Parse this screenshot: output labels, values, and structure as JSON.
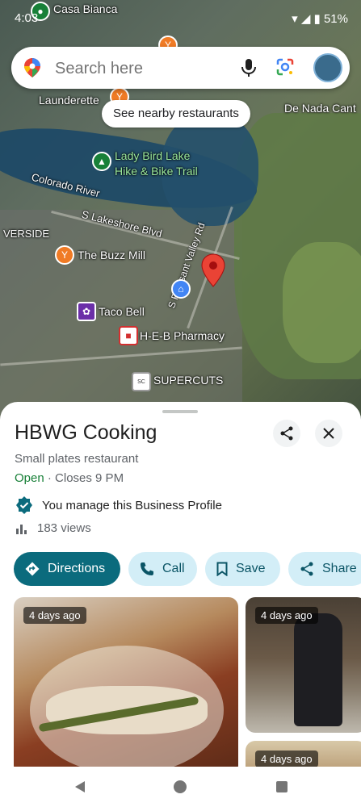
{
  "status": {
    "time": "4:03",
    "battery": "51%"
  },
  "map": {
    "labels": {
      "casa_bianca": "Casa Bianca",
      "launderette": "Launderette",
      "de_nada": "De Nada Cant",
      "lady_bird": "Lady Bird Lake",
      "hike_bike": "Hike & Bike Trail",
      "colorado": "Colorado River",
      "lakeshore": "S Lakeshore Blvd",
      "verside": "VERSIDE",
      "buzz_mill": "The Buzz Mill",
      "valley_rd": "S Pleasant Valley Rd",
      "taco_bell": "Taco Bell",
      "heb": "H-E-B Pharmacy",
      "supercuts": "SUPERCUTS"
    }
  },
  "search": {
    "placeholder": "Search here"
  },
  "chip": {
    "label": "See nearby restaurants"
  },
  "place": {
    "name": "HBWG Cooking",
    "category": "Small plates restaurant",
    "open_status": "Open",
    "closes": " · Closes 9 PM",
    "manage_text": "You manage this Business Profile",
    "views": "183 views"
  },
  "actions": {
    "directions": "Directions",
    "call": "Call",
    "save": "Save",
    "share": "Share"
  },
  "photos": {
    "badge1": "4 days ago",
    "badge2": "4 days ago",
    "badge3": "4 days ago"
  },
  "colors": {
    "primary": "#0b6b7d",
    "tonal": "#d3eef7",
    "open_green": "#188038",
    "pin_red": "#ea4335"
  }
}
